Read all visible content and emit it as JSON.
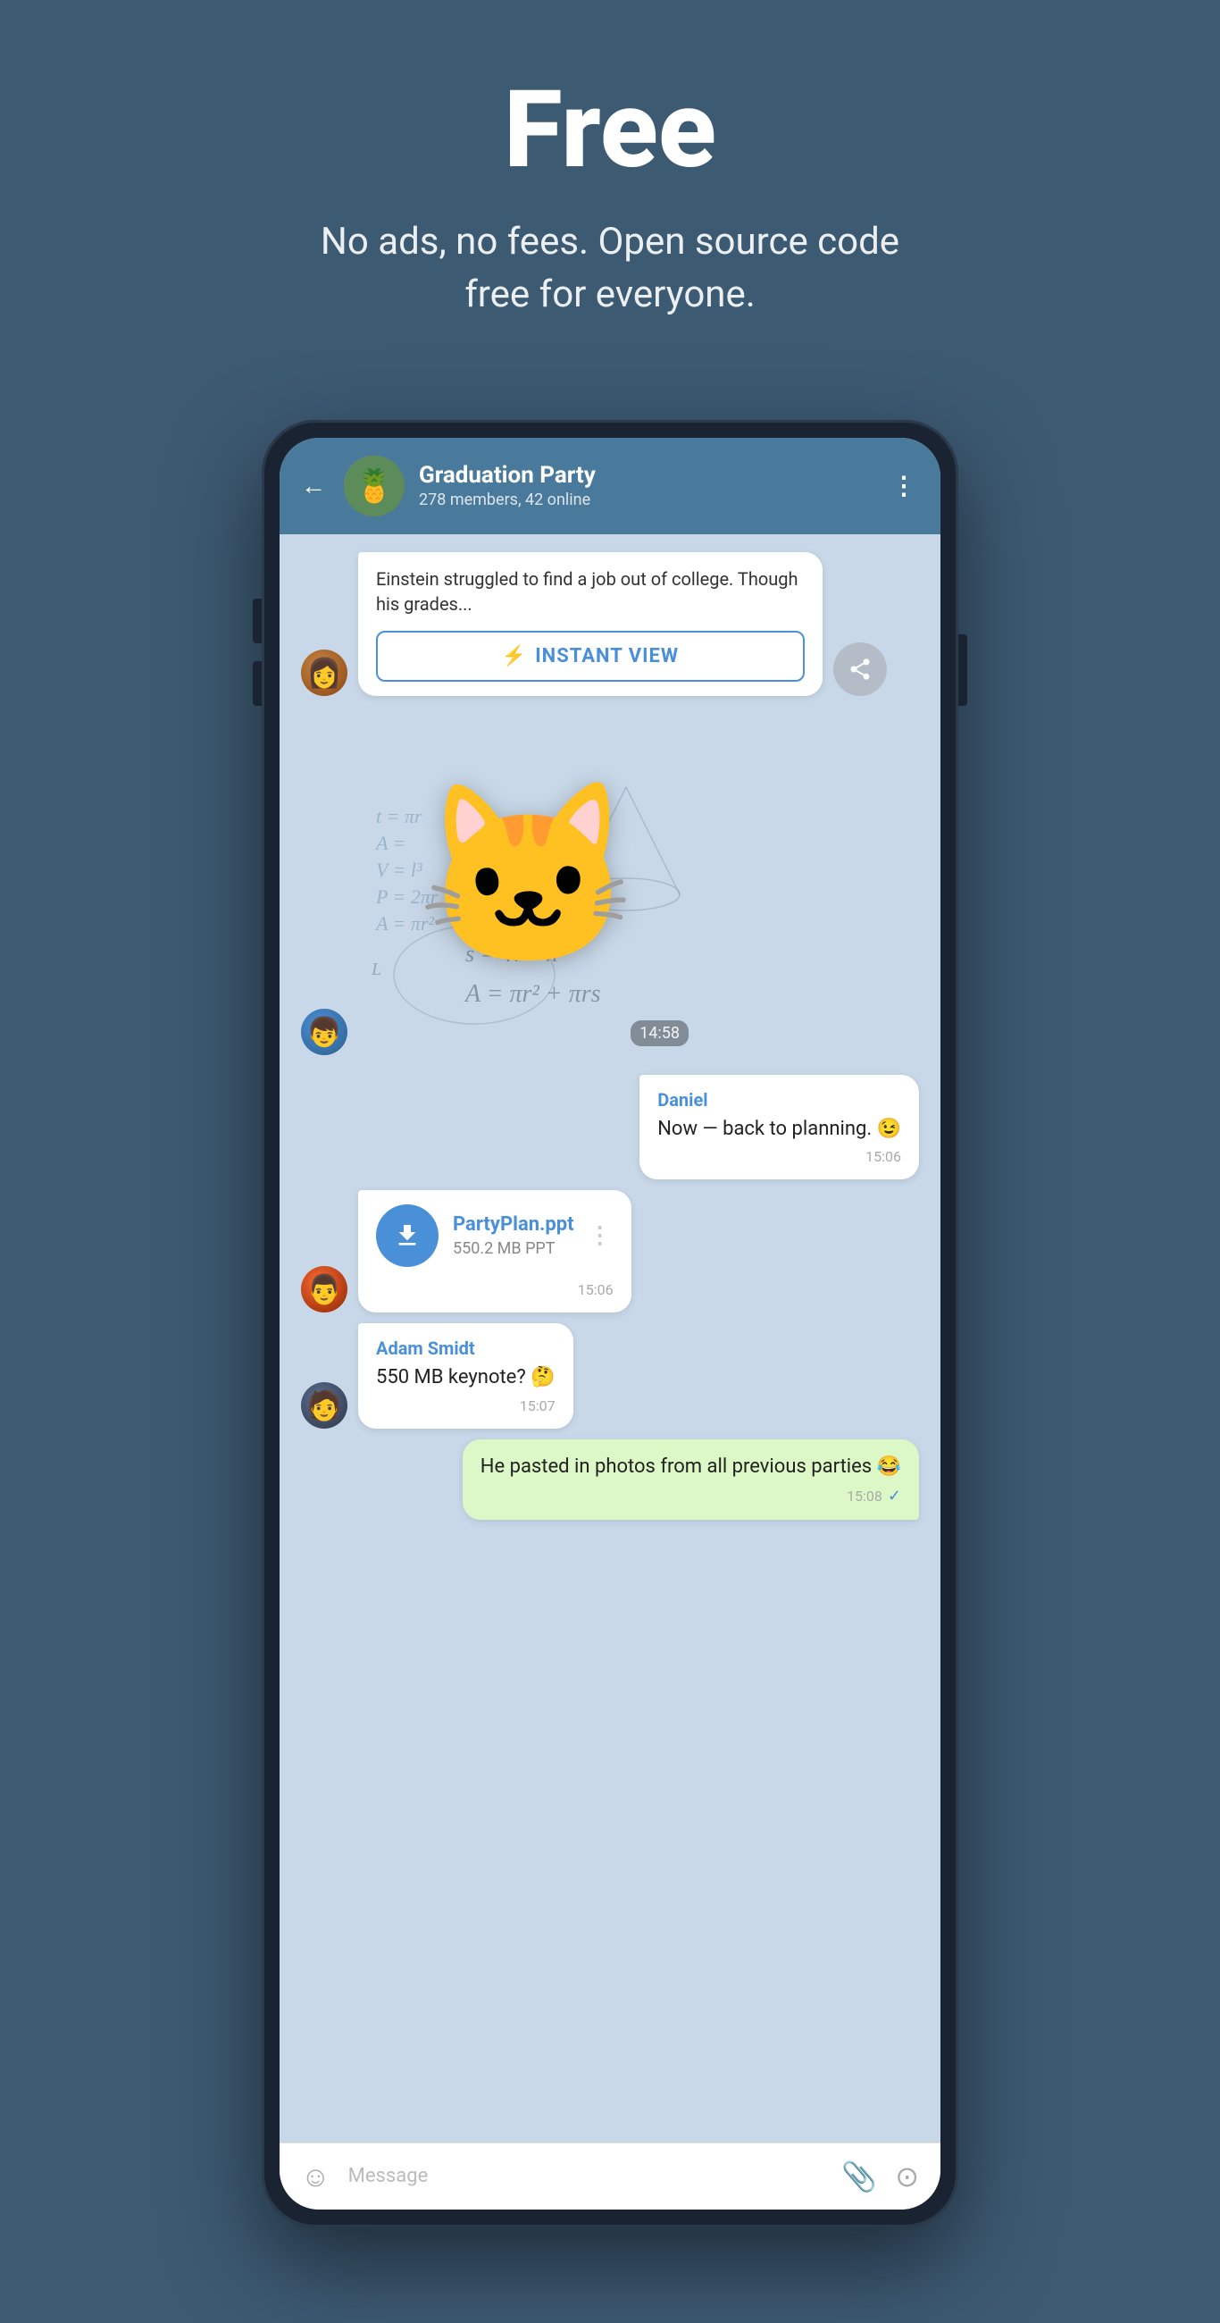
{
  "hero": {
    "title": "Free",
    "subtitle": "No ads, no fees. Open source code free for everyone."
  },
  "chat": {
    "header": {
      "group_name": "Graduation Party",
      "members_info": "278 members, 42 online",
      "back_label": "←",
      "more_label": "⋮"
    },
    "messages": [
      {
        "id": "msg1",
        "type": "article",
        "text": "Einstein struggled to find a job out of college. Though his grades...",
        "instant_view_label": "INSTANT VIEW",
        "avatar": "woman",
        "share": true
      },
      {
        "id": "msg2",
        "type": "sticker",
        "time": "14:58",
        "avatar": "man1"
      },
      {
        "id": "msg3",
        "type": "text",
        "sender": "Daniel",
        "text": "Now — back to planning. 😉",
        "time": "15:06",
        "side": "right"
      },
      {
        "id": "msg4",
        "type": "file",
        "file_name": "PartyPlan.ppt",
        "file_size": "550.2 MB PPT",
        "time": "15:06",
        "avatar": "man2"
      },
      {
        "id": "msg5",
        "type": "text",
        "sender": "Adam Smidt",
        "text": "550 MB keynote? 🤔",
        "time": "15:07",
        "avatar": "man3"
      },
      {
        "id": "msg6",
        "type": "text_self",
        "text": "He pasted in photos from all previous parties 😂",
        "time": "15:08",
        "check": true,
        "side": "self"
      }
    ],
    "input": {
      "placeholder": "Message",
      "emoji_icon": "☺",
      "attach_icon": "📎",
      "camera_icon": "⊙"
    }
  }
}
